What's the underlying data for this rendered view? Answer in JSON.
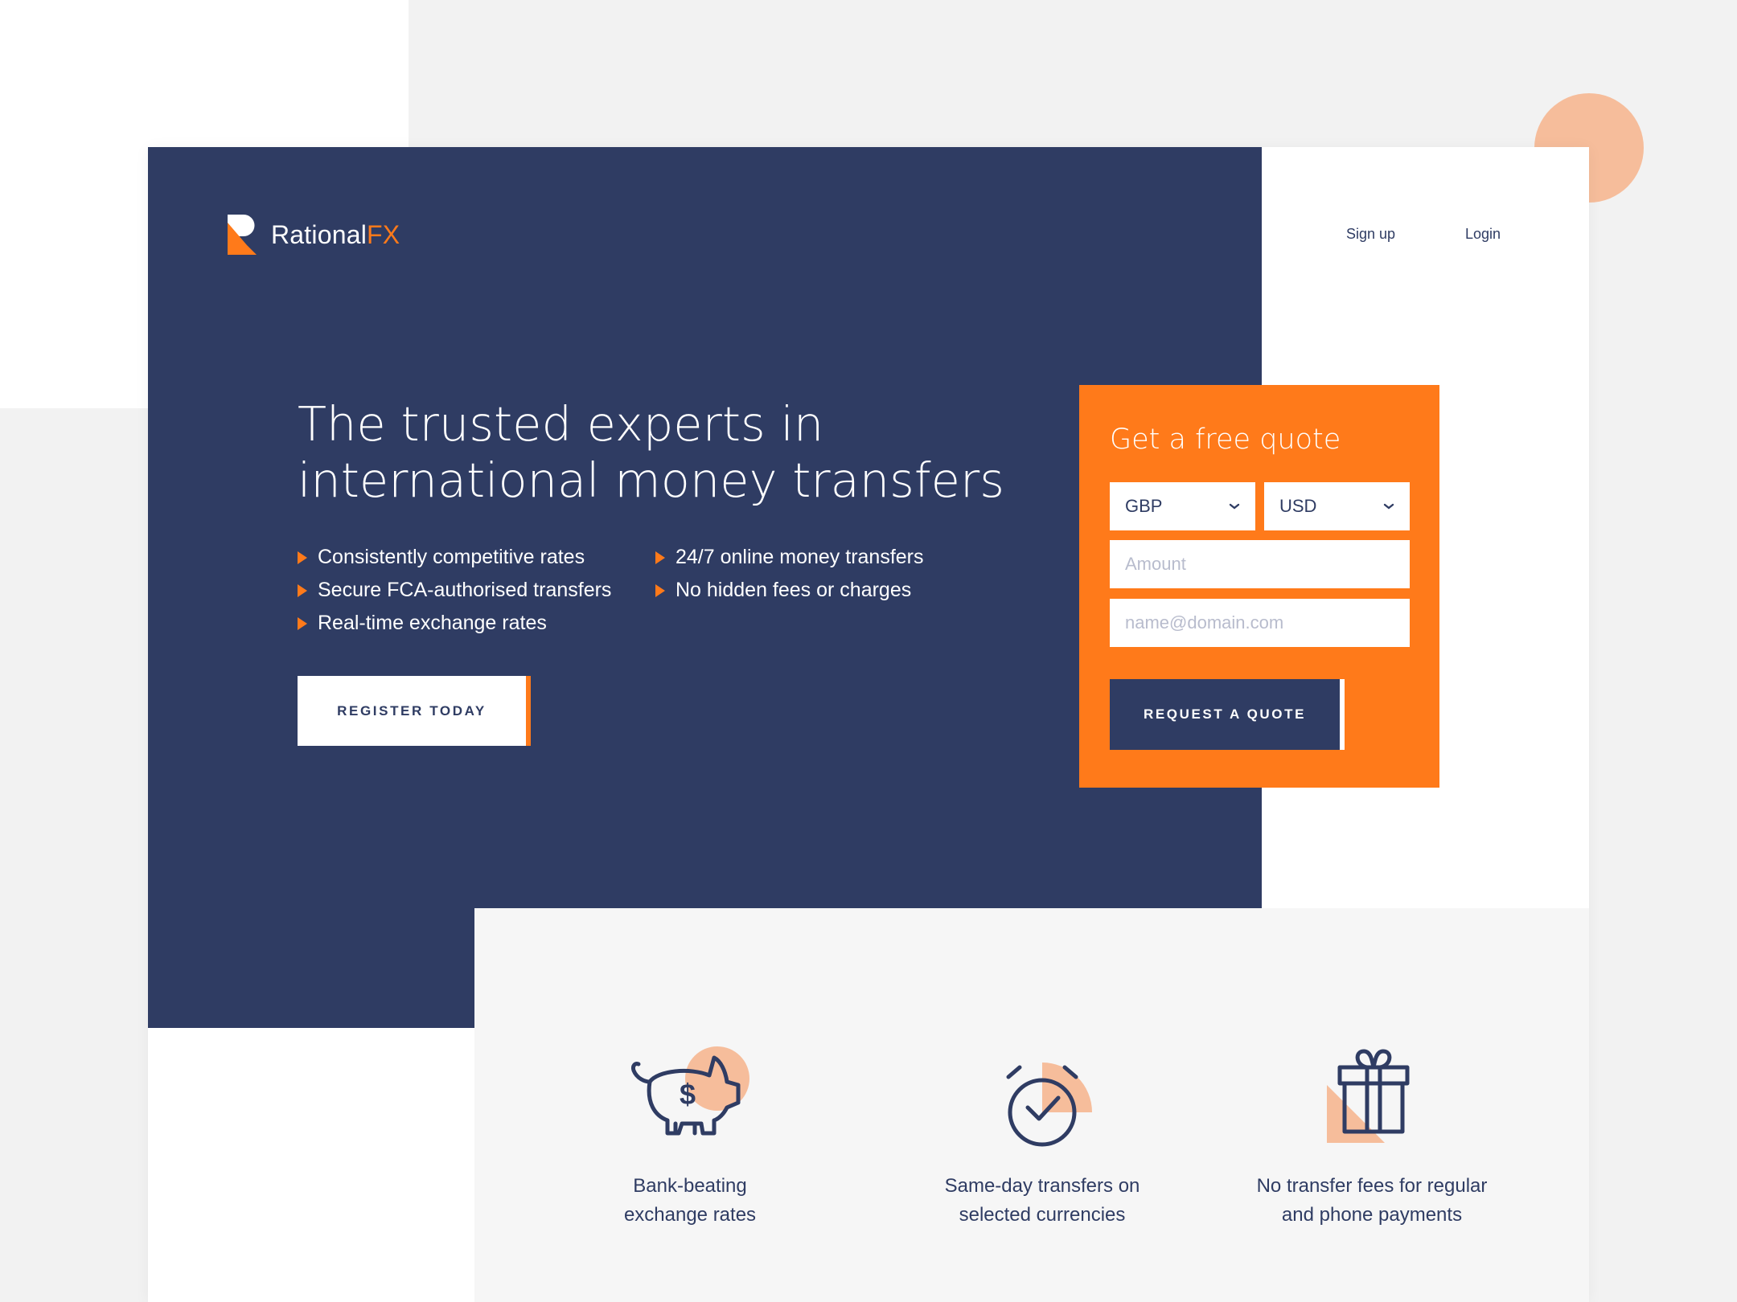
{
  "brand": {
    "name_main": "Rational",
    "name_accent": "FX",
    "colors": {
      "navy": "#2f3c63",
      "orange": "#ff7a1a",
      "peach": "#f6bd9b"
    }
  },
  "nav": {
    "signup": "Sign up",
    "login": "Login"
  },
  "hero": {
    "title_line1": "The trusted experts in",
    "title_line2": "international money transfers",
    "features_col1": [
      "Consistently competitive rates",
      "Secure FCA-authorised transfers",
      "Real-time exchange rates"
    ],
    "features_col2": [
      "24/7 online money transfers",
      "No hidden fees or charges"
    ],
    "cta": "REGISTER TODAY"
  },
  "quote": {
    "title": "Get a free quote",
    "from_currency": "GBP",
    "to_currency": "USD",
    "amount_placeholder": "Amount",
    "email_placeholder": "name@domain.com",
    "submit": "REQUEST A QUOTE"
  },
  "benefits": [
    {
      "icon": "piggy-bank-icon",
      "line1": "Bank-beating",
      "line2": "exchange rates"
    },
    {
      "icon": "stopwatch-icon",
      "line1": "Same-day transfers on",
      "line2": "selected currencies"
    },
    {
      "icon": "gift-icon",
      "line1": "No transfer fees for regular",
      "line2": "and phone payments"
    }
  ]
}
